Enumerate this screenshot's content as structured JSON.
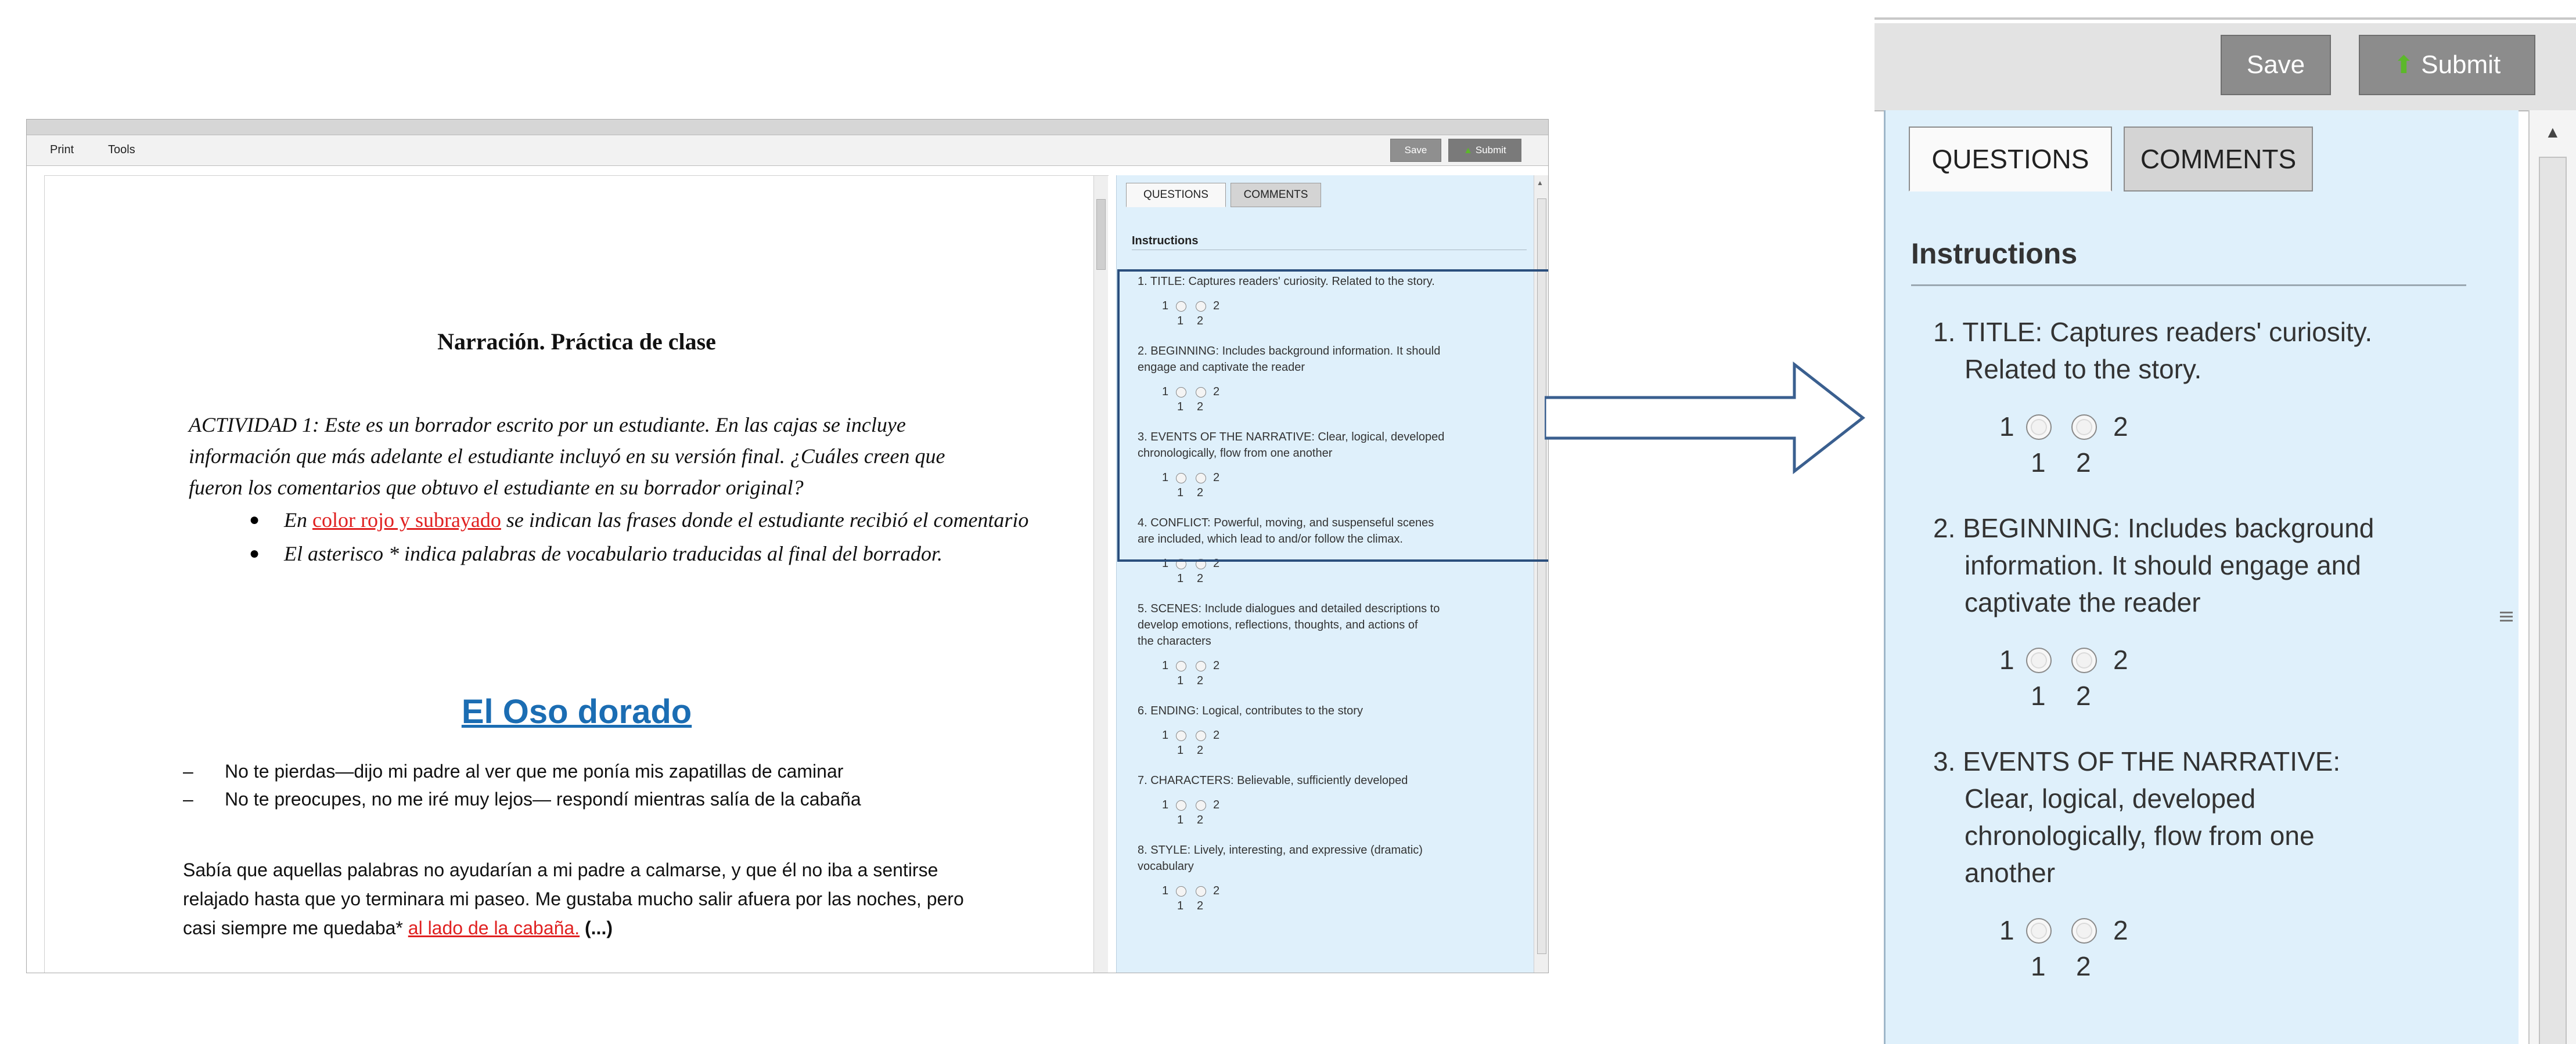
{
  "small_window": {
    "menu": [
      "Print",
      "Tools"
    ],
    "save_label": "Save",
    "submit_label": "Submit",
    "document": {
      "title": "Narración. Práctica de clase",
      "activity_lines": [
        "ACTIVIDAD 1: Este es un borrador escrito por un estudiante. En las cajas se incluye",
        "información que más adelante el estudiante incluyó en su versión final. ¿Cuáles creen que",
        "fueron los comentarios que obtuvo el estudiante en su borrador original?"
      ],
      "bullet1_pre": "En ",
      "bullet1_red": "color rojo y subrayado",
      "bullet1_post": " se indican las frases donde el estudiante recibió el comentario",
      "bullet2": "El asterisco * indica palabras de vocabulario traducidas al final del borrador.",
      "story_title": "El Oso dorado",
      "dialogue": [
        "No te pierdas—dijo mi padre al ver que me ponía mis zapatillas de caminar",
        "No te preocupes, no me iré muy lejos— respondí mientras salía de la cabaña"
      ],
      "dash": "–",
      "para_lines": [
        "Sabía que aquellas palabras no ayudarían a mi padre a calmarse, y que él no iba a sentirse",
        "relajado hasta que yo terminara mi paseo. Me gustaba mucho salir afuera por las noches, pero"
      ],
      "para_last_pre": "casi siempre me quedaba* ",
      "para_last_red": "al lado de la cabaña.",
      "para_last_post": " (...)"
    },
    "panel": {
      "tabs": [
        "QUESTIONS",
        "COMMENTS"
      ],
      "instructions": "Instructions",
      "questions": [
        {
          "lines": [
            "1. TITLE: Captures readers' curiosity. Related to the story."
          ]
        },
        {
          "lines": [
            "2. BEGINNING: Includes background information. It should",
            "engage and captivate the reader"
          ]
        },
        {
          "lines": [
            "3. EVENTS OF THE NARRATIVE: Clear, logical, developed",
            "chronologically, flow from one another"
          ]
        },
        {
          "lines": [
            "4. CONFLICT: Powerful, moving, and suspenseful scenes",
            "are included, which lead to and/or follow the climax."
          ]
        },
        {
          "lines": [
            "5. SCENES: Include dialogues and detailed descriptions to",
            "develop emotions, reflections, thoughts, and actions of",
            "the characters"
          ]
        },
        {
          "lines": [
            "6. ENDING: Logical, contributes to the story"
          ]
        },
        {
          "lines": [
            "7. CHARACTERS: Believable, sufficiently developed"
          ]
        },
        {
          "lines": [
            "8. STYLE: Lively, interesting, and expressive (dramatic)",
            "vocabulary"
          ]
        }
      ],
      "scale_left": "1",
      "scale_right": "2",
      "sub1": "1",
      "sub2": "2"
    }
  },
  "zoomed_panel": {
    "save_label": "Save",
    "submit_label": "Submit",
    "tabs": [
      "QUESTIONS",
      "COMMENTS"
    ],
    "instructions": "Instructions",
    "questions": [
      {
        "lines": [
          "1. TITLE: Captures readers' curiosity.",
          "Related to the story."
        ]
      },
      {
        "lines": [
          "2. BEGINNING: Includes background",
          "information. It should engage and",
          "captivate the reader"
        ]
      },
      {
        "lines": [
          "3. EVENTS OF THE NARRATIVE:",
          "Clear, logical, developed",
          "chronologically, flow from one",
          "another"
        ]
      }
    ],
    "scale_left": "1",
    "scale_right": "2",
    "sub1": "1",
    "sub2": "2"
  },
  "colors": {
    "panel_bg": "#dff0fb",
    "highlight_border": "#2b4f7d",
    "link_red": "#e02020",
    "story_title_blue": "#1b6db3",
    "submit_arrow_green": "#5cb82a"
  }
}
